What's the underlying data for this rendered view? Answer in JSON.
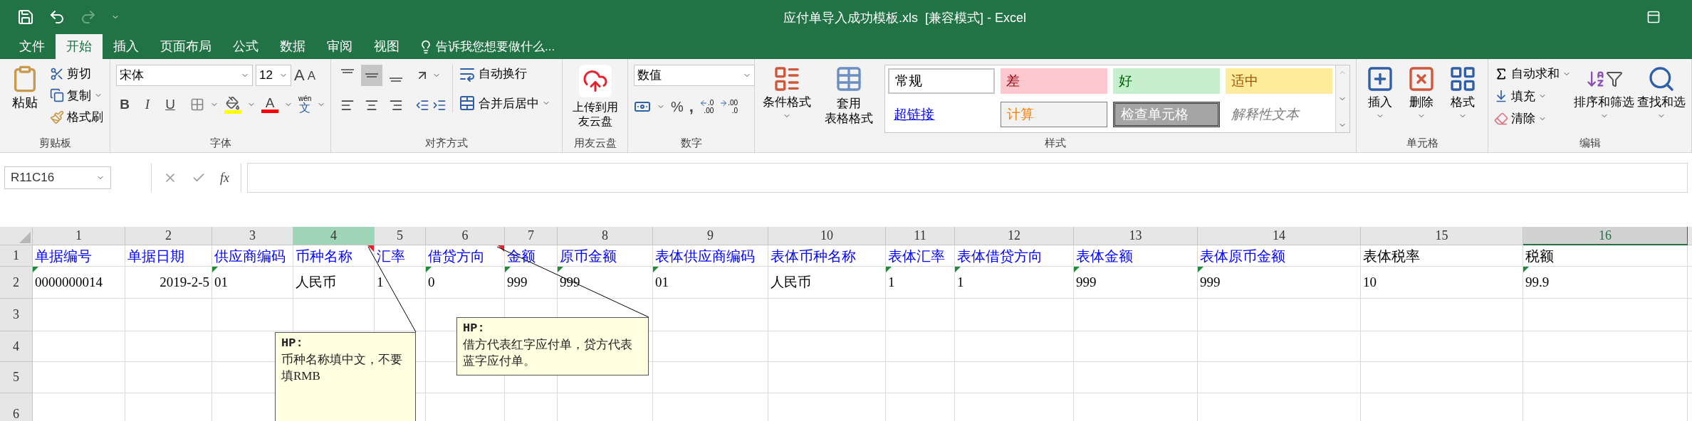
{
  "title_bar": {
    "title": "应付单导入成功模板.xls  [兼容模式] - Excel",
    "quick_access": [
      {
        "kind": "save",
        "disabled": false
      },
      {
        "kind": "undo",
        "disabled": false
      },
      {
        "kind": "redo",
        "disabled": true
      },
      {
        "kind": "customize",
        "disabled": false
      }
    ]
  },
  "tabs": [
    {
      "label": "文件",
      "selected": false
    },
    {
      "label": "开始",
      "selected": true
    },
    {
      "label": "插入",
      "selected": false
    },
    {
      "label": "页面布局",
      "selected": false
    },
    {
      "label": "公式",
      "selected": false
    },
    {
      "label": "数据",
      "selected": false
    },
    {
      "label": "审阅",
      "selected": false
    },
    {
      "label": "视图",
      "selected": false
    }
  ],
  "tell_me": "告诉我您想要做什么...",
  "ribbon": {
    "clipboard": {
      "label": "剪贴板",
      "paste": "粘贴",
      "cut": "剪切",
      "copy": "复制",
      "format_painter": "格式刷"
    },
    "font": {
      "label": "字体",
      "font_name": "宋体",
      "font_size": "12",
      "grow": "A",
      "shrink": "A",
      "styles": [
        {
          "kind": "bold",
          "text": "B"
        },
        {
          "kind": "italic",
          "text": "I"
        },
        {
          "kind": "underline",
          "text": "U"
        }
      ],
      "font_color": "A",
      "phonetic_top": "wén",
      "phonetic_bottom": "文"
    },
    "alignment": {
      "label": "对齐方式",
      "vertical": [
        {
          "kind": "top",
          "selected": false
        },
        {
          "kind": "middle",
          "selected": true
        },
        {
          "kind": "bottom",
          "selected": false
        }
      ],
      "horizontal": [
        {
          "kind": "left",
          "selected": false
        },
        {
          "kind": "center",
          "selected": false
        },
        {
          "kind": "right",
          "selected": false
        }
      ],
      "wrap": "自动换行",
      "merge": "合并后居中"
    },
    "cloud": {
      "label": "用友云盘",
      "button": "上传到用友云盘"
    },
    "number": {
      "label": "数字",
      "format": "数值",
      "percent": "%",
      "comma": ",",
      "decimals": [
        {
          "kind": "increase",
          "top": ".0",
          "bottom": ".00"
        },
        {
          "kind": "decrease",
          "top": ".00",
          "bottom": ".0"
        }
      ]
    },
    "styles": {
      "label": "样式",
      "conditional": "条件格式",
      "table_format_1": "套用",
      "table_format_2": "表格格式",
      "gallery": [
        {
          "label": "常规",
          "kind": "normal"
        },
        {
          "label": "差",
          "kind": "bad"
        },
        {
          "label": "好",
          "kind": "good"
        },
        {
          "label": "适中",
          "kind": "neutral"
        },
        {
          "label": "超链接",
          "kind": "hyperlink"
        },
        {
          "label": "计算",
          "kind": "calculation"
        },
        {
          "label": "检查单元格",
          "kind": "check"
        },
        {
          "label": "解释性文本",
          "kind": "explanatory"
        }
      ]
    },
    "cells": {
      "label": "单元格",
      "buttons": [
        {
          "label": "插入",
          "kind": "insert"
        },
        {
          "label": "删除",
          "kind": "delete"
        },
        {
          "label": "格式",
          "kind": "format"
        }
      ]
    },
    "editing": {
      "label": "编辑",
      "autosum": "自动求和",
      "fill": "填充",
      "clear": "清除",
      "sort": "排序和筛选",
      "find": "查找和选"
    }
  },
  "formula_bar": {
    "name_box": "R11C16",
    "fx": "fx"
  },
  "sheet": {
    "columns": [
      {
        "label": "1",
        "selected": false,
        "active": false
      },
      {
        "label": "2",
        "selected": false,
        "active": false
      },
      {
        "label": "3",
        "selected": false,
        "active": false
      },
      {
        "label": "4",
        "selected": true,
        "active": false
      },
      {
        "label": "5",
        "selected": false,
        "active": false
      },
      {
        "label": "6",
        "selected": false,
        "active": false
      },
      {
        "label": "7",
        "selected": false,
        "active": false
      },
      {
        "label": "8",
        "selected": false,
        "active": false
      },
      {
        "label": "9",
        "selected": false,
        "active": false
      },
      {
        "label": "10",
        "selected": false,
        "active": false
      },
      {
        "label": "11",
        "selected": false,
        "active": false
      },
      {
        "label": "12",
        "selected": false,
        "active": false
      },
      {
        "label": "13",
        "selected": false,
        "active": false
      },
      {
        "label": "14",
        "selected": false,
        "active": false
      },
      {
        "label": "15",
        "selected": false,
        "active": false
      },
      {
        "label": "16",
        "selected": false,
        "active": true
      }
    ],
    "rows": [
      {
        "header": "1",
        "cells": [
          {
            "text": "单据编号",
            "color": "#0000ff",
            "comment": false
          },
          {
            "text": "单据日期",
            "color": "#0000ff",
            "comment": false
          },
          {
            "text": "供应商编码",
            "color": "#0000ff",
            "comment": false
          },
          {
            "text": "币种名称",
            "color": "#0000ff",
            "comment": true
          },
          {
            "text": "汇率",
            "color": "#0000ff",
            "comment": false
          },
          {
            "text": "借贷方向",
            "color": "#0000ff",
            "comment": true
          },
          {
            "text": "金额",
            "color": "#0000ff",
            "comment": false
          },
          {
            "text": "原币金额",
            "color": "#0000ff",
            "comment": false
          },
          {
            "text": "表体供应商编码",
            "color": "#0000ff",
            "comment": false
          },
          {
            "text": "表体币种名称",
            "color": "#0000ff",
            "comment": false
          },
          {
            "text": "表体汇率",
            "color": "#0000ff",
            "comment": false
          },
          {
            "text": "表体借贷方向",
            "color": "#0000ff",
            "comment": false
          },
          {
            "text": "表体金额",
            "color": "#0000ff",
            "comment": false
          },
          {
            "text": "表体原币金额",
            "color": "#0000ff",
            "comment": false
          },
          {
            "text": "表体税率",
            "color": "#000000",
            "comment": false
          },
          {
            "text": "税额",
            "color": "#000000",
            "comment": false
          }
        ]
      },
      {
        "header": "2",
        "cells": [
          {
            "text": "0000000014",
            "kind": "text",
            "flagged": true
          },
          {
            "text": "2019-2-5",
            "kind": "date",
            "flagged": false
          },
          {
            "text": "01",
            "kind": "text",
            "flagged": true
          },
          {
            "text": "人民币",
            "kind": "text",
            "flagged": false
          },
          {
            "text": "1",
            "kind": "text",
            "flagged": false
          },
          {
            "text": "0",
            "kind": "text",
            "flagged": true
          },
          {
            "text": "999",
            "kind": "text",
            "flagged": true
          },
          {
            "text": "999",
            "kind": "text",
            "flagged": true
          },
          {
            "text": "01",
            "kind": "text",
            "flagged": true
          },
          {
            "text": "人民币",
            "kind": "text",
            "flagged": false
          },
          {
            "text": "1",
            "kind": "text",
            "flagged": true
          },
          {
            "text": "1",
            "kind": "text",
            "flagged": true
          },
          {
            "text": "999",
            "kind": "text",
            "flagged": true
          },
          {
            "text": "999",
            "kind": "text",
            "flagged": true
          },
          {
            "text": "10",
            "kind": "text",
            "flagged": false
          },
          {
            "text": "99.9",
            "kind": "text",
            "flagged": true
          }
        ]
      },
      {
        "header": "3"
      },
      {
        "header": "4"
      },
      {
        "header": "5"
      },
      {
        "header": "6"
      }
    ],
    "comments": [
      {
        "author": "HP:",
        "text": "币种名称填中文，不要填RMB"
      },
      {
        "author": "HP:",
        "text": "借方代表红字应付单，贷方代表蓝字应付单。"
      }
    ]
  }
}
